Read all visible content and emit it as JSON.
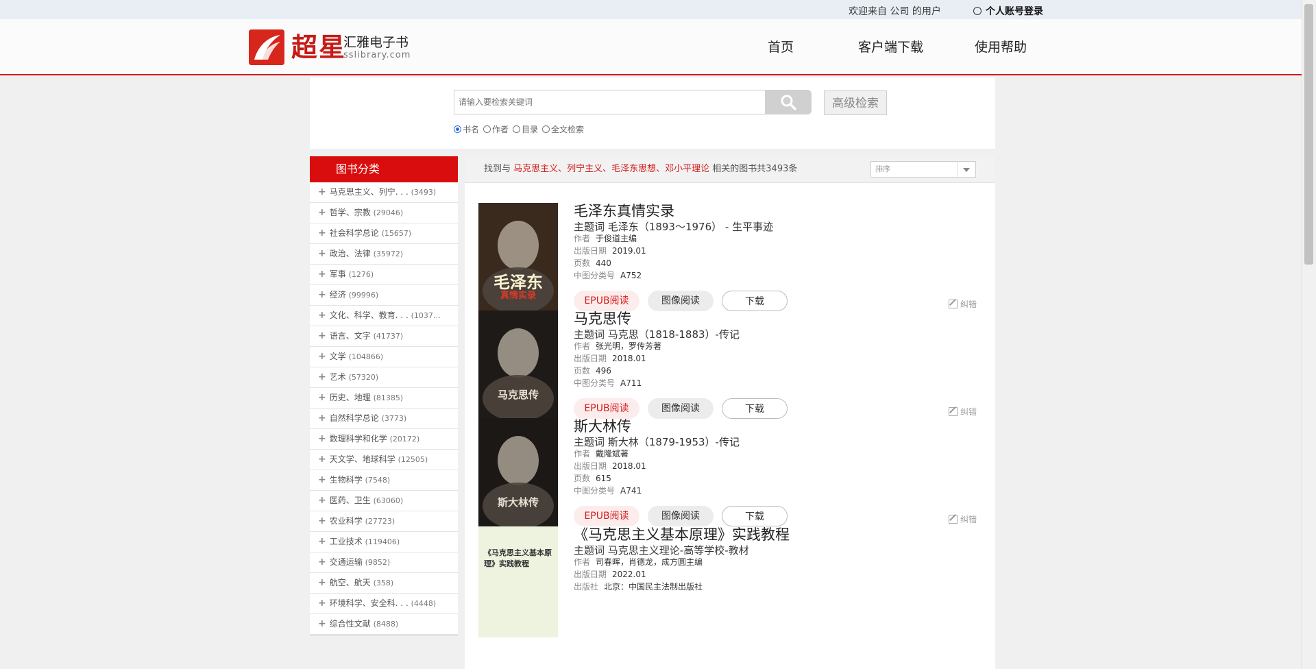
{
  "topbar": {
    "welcome": "欢迎来自  公司  的用户",
    "login": "个人账号登录"
  },
  "header": {
    "logo_cn": "超星",
    "logo_title": "汇雅电子书",
    "logo_sub": "sslibrary.com",
    "nav": [
      "首页",
      "客户端下载",
      "使用帮助"
    ]
  },
  "search": {
    "placeholder": "请输入要检索关键词",
    "advanced_label": "高级检索",
    "options": [
      "书名",
      "作者",
      "目录",
      "全文检索"
    ],
    "selected": "书名"
  },
  "sidebar": {
    "title": "图书分类",
    "categories": [
      {
        "label": "马克思主义、列宁. . .",
        "count": "(3493)"
      },
      {
        "label": "哲学、宗教",
        "count": "(29046)"
      },
      {
        "label": "社会科学总论",
        "count": "(15657)"
      },
      {
        "label": "政治、法律",
        "count": "(35972)"
      },
      {
        "label": "军事",
        "count": "(1276)"
      },
      {
        "label": "经济",
        "count": "(99996)"
      },
      {
        "label": "文化、科学、教育. . .",
        "count": "(1037…"
      },
      {
        "label": "语言、文字",
        "count": "(41737)"
      },
      {
        "label": "文学",
        "count": "(104866)"
      },
      {
        "label": "艺术",
        "count": "(57320)"
      },
      {
        "label": "历史、地理",
        "count": "(81385)"
      },
      {
        "label": "自然科学总论",
        "count": "(3773)"
      },
      {
        "label": "数理科学和化学",
        "count": "(20172)"
      },
      {
        "label": "天文学、地球科学",
        "count": "(12505)"
      },
      {
        "label": "生物科学",
        "count": "(7548)"
      },
      {
        "label": "医药、卫生",
        "count": "(63060)"
      },
      {
        "label": "农业科学",
        "count": "(27723)"
      },
      {
        "label": "工业技术",
        "count": "(119406)"
      },
      {
        "label": "交通运输",
        "count": "(9852)"
      },
      {
        "label": "航空、航天",
        "count": "(358)"
      },
      {
        "label": "环境科学、安全科. . .",
        "count": "(4448)"
      },
      {
        "label": "综合性文献",
        "count": "(8488)"
      }
    ]
  },
  "results": {
    "prefix": "找到与 ",
    "keywords": "马克思主义、列宁主义、毛泽东思想、邓小平理论",
    "suffix": " 相关的图书共3493条",
    "sort_placeholder": "排序"
  },
  "labels": {
    "subject": "主题词",
    "author": "作者",
    "date": "出版日期",
    "pages": "页数",
    "clc": "中图分类号",
    "publisher": "出版社",
    "epub": "EPUB阅读",
    "image": "图像阅读",
    "download": "下载",
    "fix": "纠错"
  },
  "books": [
    {
      "title": "毛泽东真情实录",
      "subject": "毛泽东（1893～1976）  - 生平事迹",
      "author": "于俊道主编",
      "date": "2019.01",
      "pages": "440",
      "clc": "A752",
      "cover_title": "毛泽东",
      "cover_sub": "真情实录",
      "cover_bg": "#3a2a1e"
    },
    {
      "title": "马克思传",
      "subject": "马克思（1818-1883）-传记",
      "author": "张光明，罗传芳著",
      "date": "2018.01",
      "pages": "496",
      "clc": "A711",
      "cover_title": "马克思传",
      "cover_bg": "#1e1a18"
    },
    {
      "title": "斯大林传",
      "subject": "斯大林（1879-1953）-传记",
      "author": "戴隆斌著",
      "date": "2018.01",
      "pages": "615",
      "clc": "A741",
      "cover_title": "斯大林传",
      "cover_bg": "#1c1816"
    },
    {
      "title": "《马克思主义基本原理》实践教程",
      "subject": "马克思主义理论-高等学校-教材",
      "author": "司春晖，肖德龙，成方圆主编",
      "date": "2022.01",
      "publisher": "北京：中国民主法制出版社",
      "cover_title": "《马克思主义基本原理》实践教程",
      "cover_bg": "#eef3df"
    }
  ]
}
